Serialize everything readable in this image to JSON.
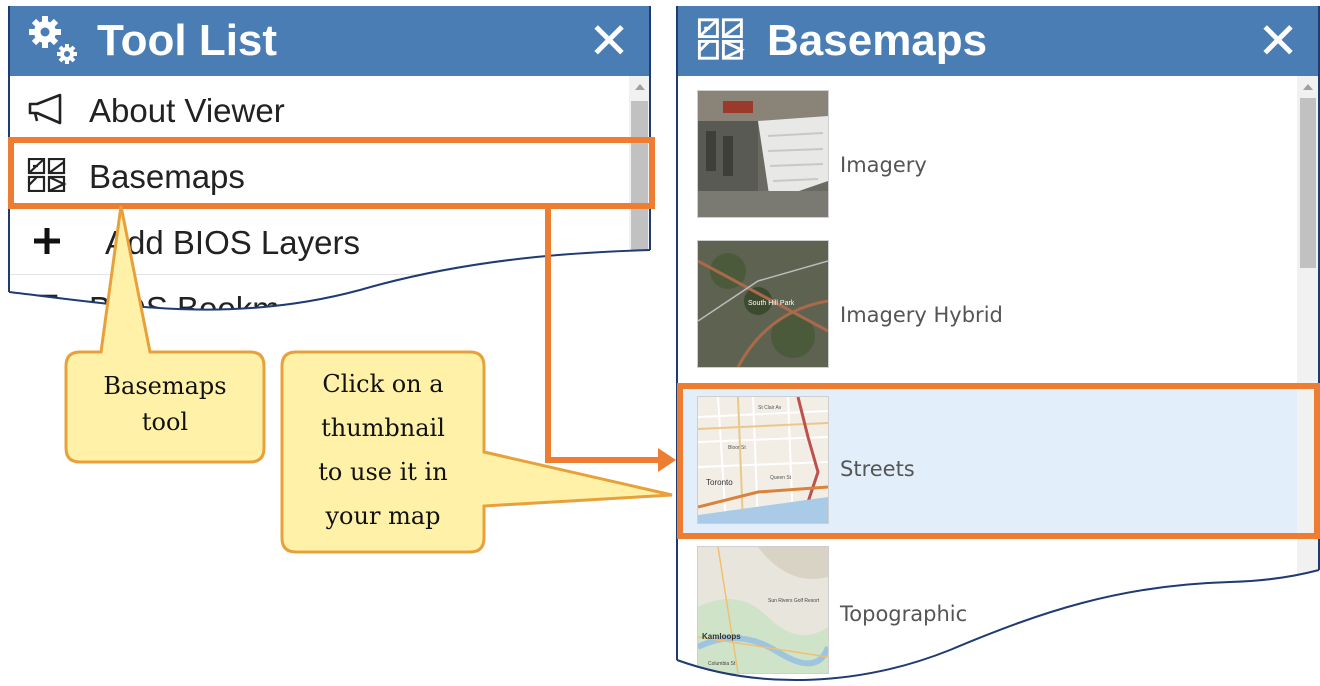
{
  "tool_list": {
    "title": "Tool List",
    "close_glyph": "✕",
    "items": [
      {
        "label": "About Viewer",
        "icon": "megaphone-icon"
      },
      {
        "label": "Basemaps",
        "icon": "basemap-grid-icon"
      },
      {
        "label": "Add BIOS Layers",
        "icon": "plus-icon"
      },
      {
        "label": "BIOS Bookm",
        "icon": "bookmark-icon"
      }
    ]
  },
  "basemaps": {
    "title": "Basemaps",
    "close_glyph": "✕",
    "items": [
      {
        "label": "Imagery",
        "thumb": "imagery-thumbnail"
      },
      {
        "label": "Imagery Hybrid",
        "thumb": "imagery-hybrid-thumbnail",
        "thumb_text": "South Hill Park"
      },
      {
        "label": "Streets",
        "thumb": "streets-thumbnail",
        "selected": true,
        "thumb_texts": [
          "Toronto",
          "St Clair Av",
          "Bloor St",
          "Queen St"
        ]
      },
      {
        "label": "Topographic",
        "thumb": "topographic-thumbnail",
        "thumb_texts": [
          "Kamloops",
          "Sun Rivers Golf Resort",
          "Columbia St"
        ]
      }
    ]
  },
  "callouts": {
    "basemaps_tool": [
      "Basemaps",
      "tool"
    ],
    "thumbnail_hint": [
      "Click on a",
      "thumbnail",
      "to use it in",
      "your map"
    ]
  },
  "colors": {
    "header_blue": "#4a7db3",
    "highlight_orange": "#ed7d31",
    "callout_fill": "#fff2a8",
    "callout_border": "#e8a03a",
    "selected_bg": "#e2effb"
  }
}
